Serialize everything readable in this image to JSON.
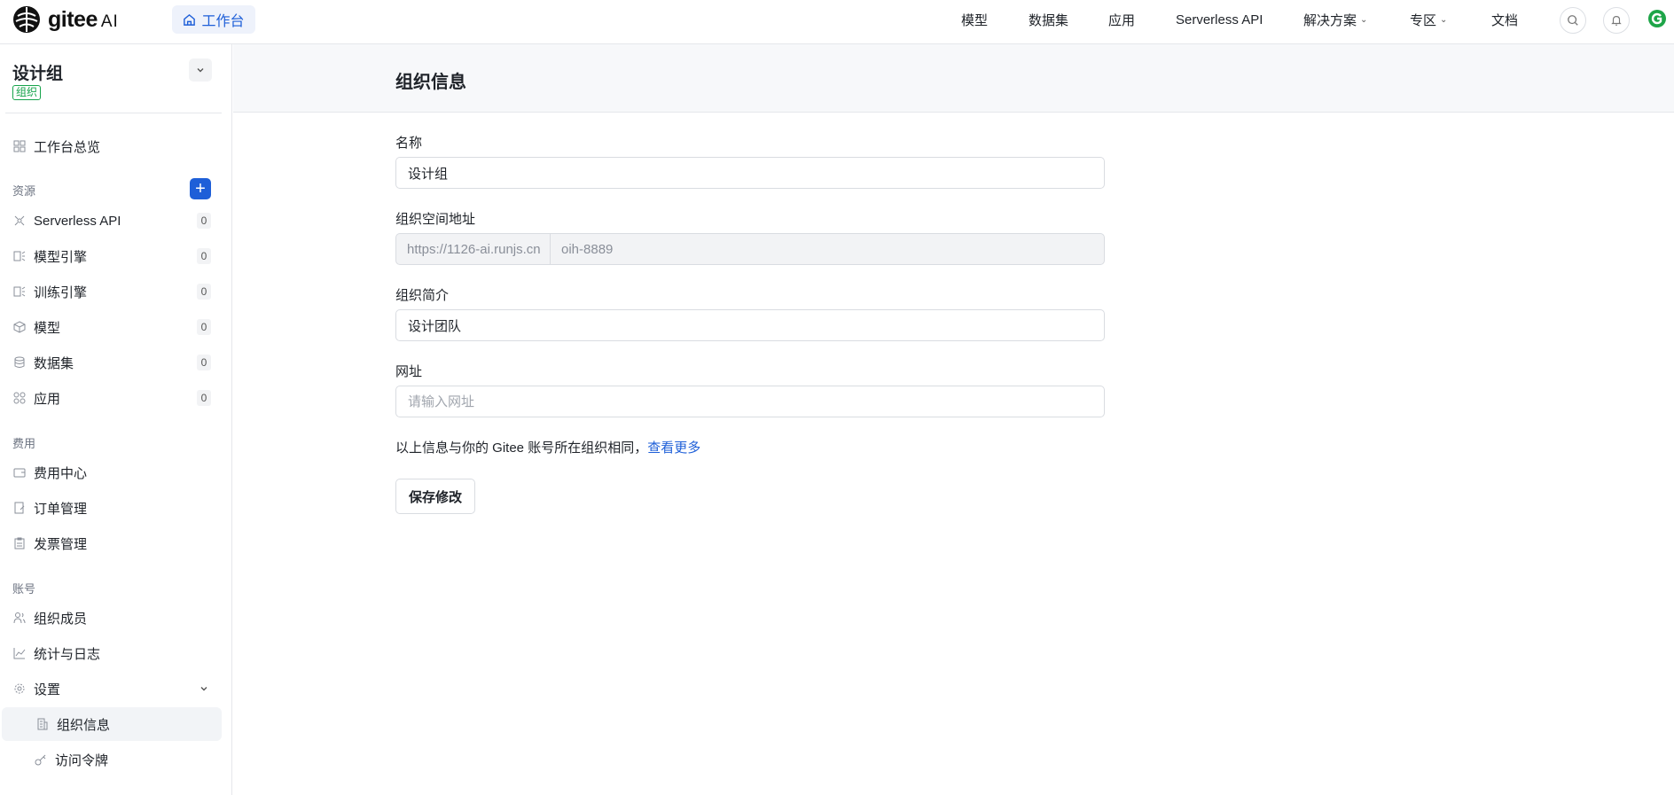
{
  "topbar": {
    "logo_text": "gitee",
    "logo_suffix": "AI",
    "workbench_label": "工作台",
    "nav": [
      {
        "label": "模型"
      },
      {
        "label": "数据集"
      },
      {
        "label": "应用"
      },
      {
        "label": "Serverless API"
      },
      {
        "label": "解决方案"
      },
      {
        "label": "专区"
      },
      {
        "label": "文档"
      }
    ]
  },
  "sidebar": {
    "org_name": "设计组",
    "org_badge": "组织",
    "overview": "工作台总览",
    "section_resources": "资源",
    "resources": [
      {
        "label": "Serverless API",
        "count": "0"
      },
      {
        "label": "模型引擎",
        "count": "0"
      },
      {
        "label": "训练引擎",
        "count": "0"
      },
      {
        "label": "模型",
        "count": "0"
      },
      {
        "label": "数据集",
        "count": "0"
      },
      {
        "label": "应用",
        "count": "0"
      }
    ],
    "section_billing": "费用",
    "billing": [
      {
        "label": "费用中心"
      },
      {
        "label": "订单管理"
      },
      {
        "label": "发票管理"
      }
    ],
    "section_account": "账号",
    "account": [
      {
        "label": "组织成员"
      },
      {
        "label": "统计与日志"
      },
      {
        "label": "设置"
      }
    ],
    "settings_sub": [
      {
        "label": "组织信息"
      },
      {
        "label": "访问令牌"
      }
    ]
  },
  "main": {
    "title": "组织信息",
    "name_label": "名称",
    "name_value": "设计组",
    "address_label": "组织空间地址",
    "address_prefix": "https://1126-ai.runjs.cn",
    "address_value": "oih-8889",
    "intro_label": "组织简介",
    "intro_value": "设计团队",
    "website_label": "网址",
    "website_placeholder": "请输入网址",
    "note_text": "以上信息与你的 Gitee 账号所在组织相同，",
    "note_link": "查看更多",
    "save_label": "保存修改"
  },
  "colors": {
    "accent": "#1e5fd8",
    "badge_green": "#16a34a"
  }
}
